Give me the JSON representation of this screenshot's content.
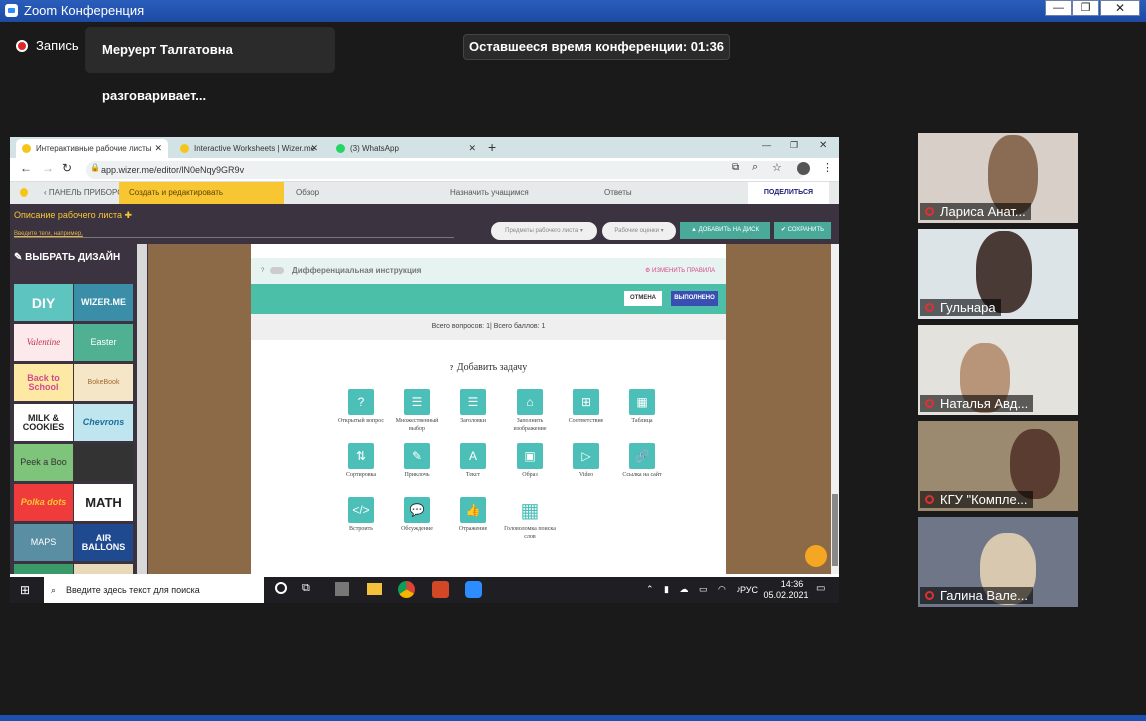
{
  "zoom": {
    "title": "Zoom Конференция",
    "recording_label": "Запись",
    "speaking": "Меруерт Талгатовна разговаривает...",
    "timer": "Оставшееся время конференции: 01:36"
  },
  "browser": {
    "tabs": [
      {
        "title": "Интерактивные рабочие листы",
        "active": true
      },
      {
        "title": "Interactive Worksheets | Wizer.me",
        "active": false
      },
      {
        "title": "(3) WhatsApp",
        "active": false
      }
    ],
    "url": "app.wizer.me/editor/lN0eNqy9GR9v"
  },
  "wizer": {
    "dashboard": "ПАНЕЛЬ ПРИБОРОВ",
    "steps": [
      "Создать и редактировать",
      "Обзор",
      "Назначить учащимся",
      "Ответы"
    ],
    "share": "ПОДЕЛИТЬСЯ ЛИСТОМ",
    "desc_title": "Описание рабочего листа",
    "tags_hint": "Введите теги, например,",
    "subjects": "Предметы рабочего листа",
    "grades": "Рабочие оценки",
    "add_drive": "ДОБАВИТЬ НА ДИСК",
    "save": "СОХРАНИТЬ",
    "design_title": "ВЫБРАТЬ ДИЗАЙН",
    "designs": [
      "DIY",
      "WIZER.ME",
      "Valentine",
      "Easter",
      "Back to School",
      "BokeBook",
      "MILK & COOKIES",
      "Chevrons",
      "Peek a Boo",
      "",
      "Polka dots",
      "MATH",
      "MAPS",
      "AIR BALLONS"
    ],
    "diff": {
      "q": "?",
      "label": "Дифференциальная инструкция",
      "edit": "ИЗМЕНИТЬ ПРАВИЛА"
    },
    "cancel": "ОТМЕНА",
    "done": "ВЫПОЛНЕНО",
    "totals": "Всего вопросов: 1| Всего баллов: 1",
    "add_task": "Добавить задачу",
    "tasks": [
      "Открытый вопрос",
      "Множественный выбор",
      "Заголовки",
      "Заполнить изображение",
      "Соответствие",
      "Таблица",
      "Сортировка",
      "Приклочь",
      "Текст",
      "Образ",
      "Video",
      "Ссылка на сайт",
      "Встроить",
      "Обсуждение",
      "Отражение",
      "Головоломка поиска слов"
    ]
  },
  "taskbar": {
    "search": "Введите здесь текст для поиска",
    "lang": "РУС",
    "time": "14:36",
    "date": "05.02.2021"
  },
  "participants": [
    "Лариса Анат...",
    "Гульнара",
    "Наталья Авд...",
    "КГУ \"Компле...",
    "Галина Вале..."
  ]
}
